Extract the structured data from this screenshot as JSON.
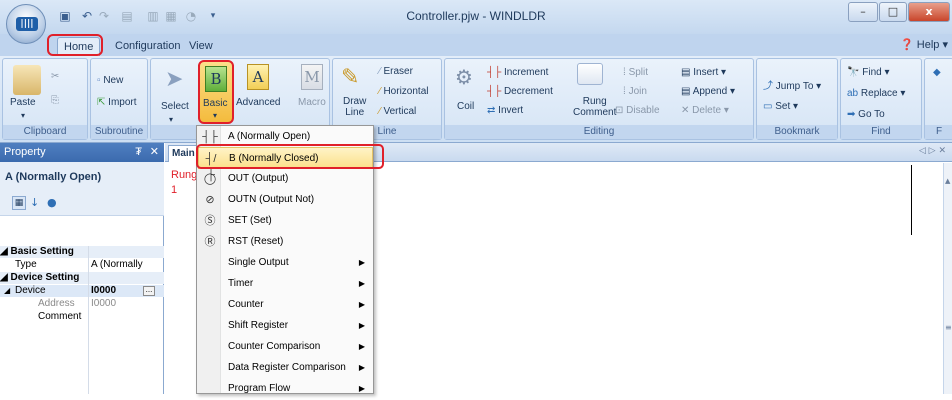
{
  "window": {
    "title": "Controller.pjw - WINDLDR",
    "minimize": "–",
    "maximize": "□",
    "close": "x"
  },
  "tabs": [
    {
      "label": "Home"
    },
    {
      "label": "Configuration"
    },
    {
      "label": "View"
    }
  ],
  "help": "Help",
  "ribbon": {
    "groups": [
      {
        "label": "Clipboard"
      },
      {
        "label": "Subroutine"
      },
      {
        "label": ""
      },
      {
        "label": "Line"
      },
      {
        "label": "Editing"
      },
      {
        "label": "Bookmark"
      },
      {
        "label": "Find"
      },
      {
        "label": "F"
      }
    ],
    "paste": "Paste",
    "new": "New",
    "import": "Import",
    "select": "Select",
    "basic": "Basic",
    "advanced": "Advanced",
    "macro": "Macro",
    "draw_line": "Draw Line",
    "draw_line_1": "Draw",
    "draw_line_2": "Line",
    "eraser": "Eraser",
    "horizontal": "Horizontal",
    "vertical": "Vertical",
    "coil": "Coil",
    "increment": "Increment",
    "decrement": "Decrement",
    "invert": "Invert",
    "rung_comment_1": "Rung",
    "rung_comment_2": "Comment",
    "split": "Split",
    "join": "Join",
    "disable": "Disable",
    "insert": "Insert",
    "append": "Append",
    "delete": "Delete",
    "jump_to": "Jump To",
    "set": "Set",
    "find": "Find",
    "replace": "Replace",
    "go_to": "Go To"
  },
  "property": {
    "header": "Property",
    "pin": "₮",
    "close": "✕",
    "name": "A (Normally Open)",
    "sections": [
      {
        "title": "Basic Setting",
        "rows": [
          {
            "key": "Type",
            "value": "A (Normally"
          }
        ]
      },
      {
        "title": "Device Setting",
        "rows": [
          {
            "key": "Device",
            "value": "I0000"
          },
          {
            "key": "Address",
            "value": "I0000"
          },
          {
            "key": "Comment",
            "value": ""
          }
        ]
      }
    ]
  },
  "editor": {
    "tab": "Main",
    "rung_label": "Rung",
    "rung_number": "1",
    "nav": "◁ ▷ ✕"
  },
  "menu": [
    {
      "label": "A (Normally Open)",
      "icon": "no-contact-icon",
      "glyph": "┤├"
    },
    {
      "label": "B (Normally Closed)",
      "icon": "nc-contact-icon",
      "glyph": "┤/├"
    },
    {
      "label": "OUT (Output)",
      "icon": "out-coil-icon",
      "glyph": "◯"
    },
    {
      "label": "OUTN (Output Not)",
      "icon": "outn-coil-icon",
      "glyph": "⊘"
    },
    {
      "label": "SET (Set)",
      "icon": "set-coil-icon",
      "glyph": "Ⓢ"
    },
    {
      "label": "RST (Reset)",
      "icon": "rst-coil-icon",
      "glyph": "Ⓡ"
    },
    {
      "label": "Single Output",
      "submenu": true
    },
    {
      "label": "Timer",
      "submenu": true
    },
    {
      "label": "Counter",
      "submenu": true
    },
    {
      "label": "Shift Register",
      "submenu": true
    },
    {
      "label": "Counter Comparison",
      "submenu": true
    },
    {
      "label": "Data Register Comparison",
      "submenu": true
    },
    {
      "label": "Program Flow",
      "submenu": true
    }
  ],
  "colors": {
    "highlight": "#e0202a",
    "ribbon": "#dbe8f7",
    "menu_hover": "#fbe08a"
  }
}
